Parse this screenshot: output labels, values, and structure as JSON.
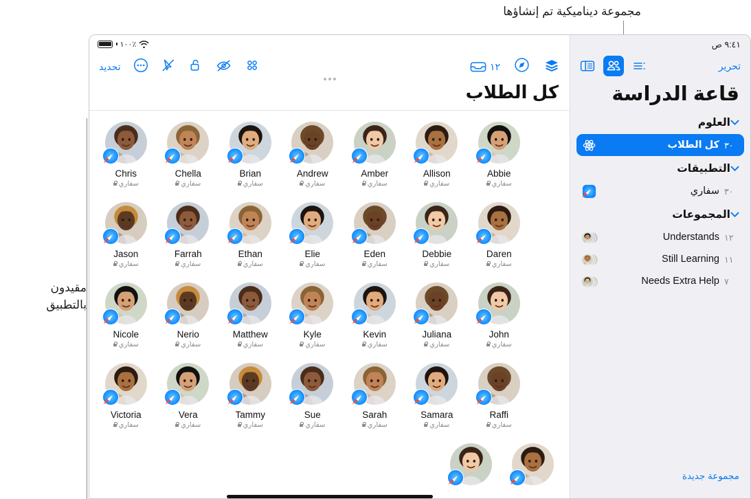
{
  "annotations": {
    "top_callout": "مجموعة ديناميكية تم إنشاؤها",
    "left_callout": "مقيدون\nبالتطبيق"
  },
  "sidebar": {
    "status_time": "٩:٤١ ص",
    "edit_label": "تحرير",
    "title": "قاعة الدراسة",
    "icons": {
      "sidebar_toggle": "sidebar-toggle-icon",
      "people": "people-icon",
      "list": "list-icon"
    },
    "sections": [
      {
        "title": "العلوم",
        "chevron": "⌄",
        "rows": [
          {
            "label": "كل الطلاب",
            "count": "٣٠",
            "icon": "atom-icon",
            "active": true
          }
        ]
      },
      {
        "title": "التطبيقات",
        "chevron": "⌄",
        "rows": [
          {
            "label": "سفاري",
            "count": "٣٠",
            "icon": "safari-icon",
            "active": false
          }
        ]
      },
      {
        "title": "المجموعات",
        "chevron": "⌄",
        "rows": [
          {
            "label": "Understands",
            "count": "١٢",
            "icon": "avatar-stack-icon",
            "active": false
          },
          {
            "label": "Still Learning",
            "count": "١١",
            "icon": "avatar-stack-icon",
            "active": false
          },
          {
            "label": "Needs Extra Help",
            "count": "٧",
            "icon": "avatar-stack-icon",
            "active": false
          }
        ]
      }
    ],
    "new_group_label": "مجموعة جديدة"
  },
  "main": {
    "status": {
      "battery_pct": "١٠٠٪",
      "wifi": "wifi-icon",
      "battery": "battery-icon"
    },
    "toolbar_left": [
      {
        "name": "select-button",
        "label": "تحديد",
        "icon": ""
      },
      {
        "name": "more-button",
        "label": "",
        "icon": "more-circle-icon"
      },
      {
        "name": "pointer-off-button",
        "label": "",
        "icon": "cursor-slash-icon"
      },
      {
        "name": "unlock-button",
        "label": "",
        "icon": "unlock-icon"
      },
      {
        "name": "hide-screen-button",
        "label": "",
        "icon": "eye-slash-icon"
      },
      {
        "name": "apps-grid-button",
        "label": "",
        "icon": "apps-grid-icon"
      }
    ],
    "toolbar_right": [
      {
        "name": "layers-button",
        "label": "",
        "icon": "layers-icon"
      },
      {
        "name": "navigate-button",
        "label": "",
        "icon": "compass-icon"
      },
      {
        "name": "inbox-button",
        "label": "١٢",
        "icon": "tray-icon"
      }
    ],
    "title": "كل الطلاب",
    "app_sub_label": "سفاري",
    "students": [
      {
        "name": "Chris",
        "app": "سفاري"
      },
      {
        "name": "Chella",
        "app": "سفاري"
      },
      {
        "name": "Brian",
        "app": "سفاري"
      },
      {
        "name": "Andrew",
        "app": "سفاري"
      },
      {
        "name": "Amber",
        "app": "سفاري"
      },
      {
        "name": "Allison",
        "app": "سفاري"
      },
      {
        "name": "Abbie",
        "app": "سفاري"
      },
      {
        "name": "Jason",
        "app": "سفاري"
      },
      {
        "name": "Farrah",
        "app": "سفاري"
      },
      {
        "name": "Ethan",
        "app": "سفاري"
      },
      {
        "name": "Elie",
        "app": "سفاري"
      },
      {
        "name": "Eden",
        "app": "سفاري"
      },
      {
        "name": "Debbie",
        "app": "سفاري"
      },
      {
        "name": "Daren",
        "app": "سفاري"
      },
      {
        "name": "Nicole",
        "app": "سفاري"
      },
      {
        "name": "Nerio",
        "app": "سفاري"
      },
      {
        "name": "Matthew",
        "app": "سفاري"
      },
      {
        "name": "Kyle",
        "app": "سفاري"
      },
      {
        "name": "Kevin",
        "app": "سفاري"
      },
      {
        "name": "Juliana",
        "app": "سفاري"
      },
      {
        "name": "John",
        "app": "سفاري"
      },
      {
        "name": "Victoria",
        "app": "سفاري"
      },
      {
        "name": "Vera",
        "app": "سفاري"
      },
      {
        "name": "Tammy",
        "app": "سفاري"
      },
      {
        "name": "Sue",
        "app": "سفاري"
      },
      {
        "name": "Sarah",
        "app": "سفاري"
      },
      {
        "name": "Samara",
        "app": "سفاري"
      },
      {
        "name": "Raffi",
        "app": "سفاري"
      }
    ],
    "partial_row_count": 2
  },
  "colors": {
    "accent": "#0a7bf2",
    "sidebar_bg": "#f0f0f4",
    "main_bg": "#ffffff",
    "text": "#111111",
    "muted": "#8a8a8e"
  }
}
